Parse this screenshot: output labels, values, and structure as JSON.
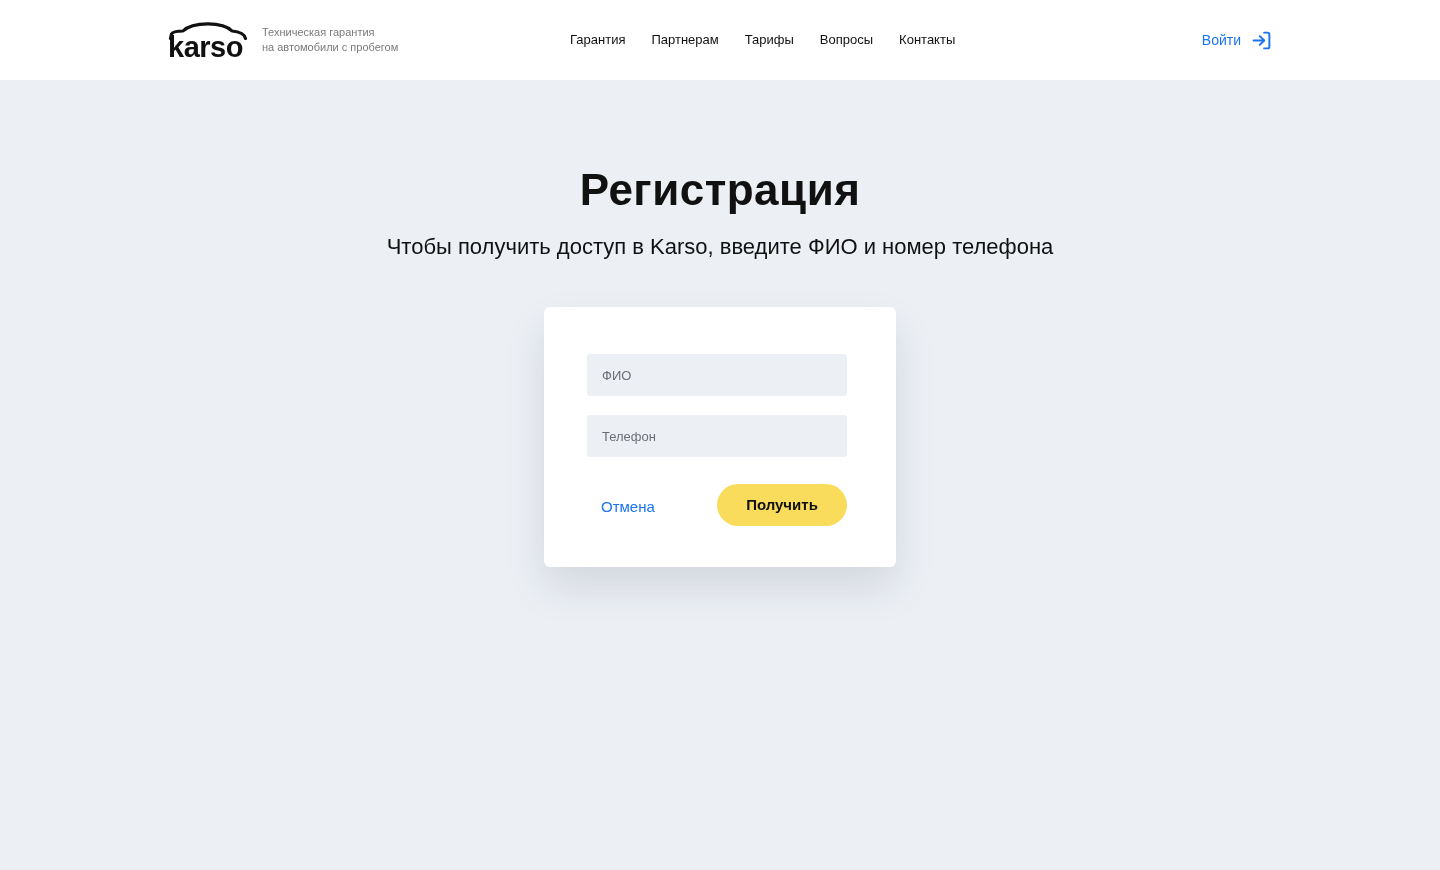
{
  "header": {
    "logo": {
      "text": "karso"
    },
    "tagline": [
      "Техническая гарантия",
      "на автомобили с пробегом"
    ],
    "nav": [
      {
        "label": "Гарантия"
      },
      {
        "label": "Партнерам"
      },
      {
        "label": "Тарифы"
      },
      {
        "label": "Вопросы"
      },
      {
        "label": "Контакты"
      }
    ],
    "login": {
      "label": "Войти"
    }
  },
  "page": {
    "title": "Регистрация",
    "subtitle": "Чтобы получить доступ в Karso, введите ФИО и номер телефона"
  },
  "form": {
    "fields": [
      {
        "placeholder": "ФИО"
      },
      {
        "placeholder": "Телефон"
      }
    ],
    "cancel": {
      "label": "Отмена"
    },
    "submit": {
      "label": "Получить"
    }
  }
}
